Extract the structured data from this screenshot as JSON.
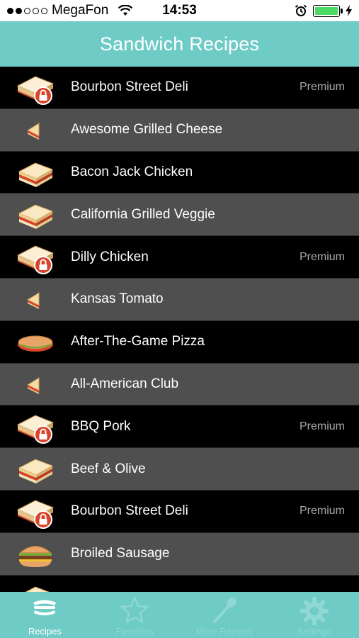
{
  "status_bar": {
    "carrier": "MegaFon",
    "time": "14:53",
    "signal_bars_filled": 2,
    "signal_bars_total": 5,
    "battery_level": 1.0,
    "battery_color": "#4cd964"
  },
  "nav": {
    "title": "Sandwich Recipes",
    "color": "#6ecbc5"
  },
  "recipes": [
    {
      "name": "Bourbon Street Deli",
      "badge": "Premium",
      "icon": "sandwich-locked-icon"
    },
    {
      "name": "Awesome Grilled Cheese",
      "badge": "",
      "icon": "sandwich-wedge-icon"
    },
    {
      "name": "Bacon Jack Chicken",
      "badge": "",
      "icon": "sandwich-icon"
    },
    {
      "name": "California Grilled Veggie",
      "badge": "",
      "icon": "sandwich-icon"
    },
    {
      "name": "Dilly Chicken",
      "badge": "Premium",
      "icon": "sandwich-locked-icon"
    },
    {
      "name": "Kansas Tomato",
      "badge": "",
      "icon": "sandwich-wedge-icon"
    },
    {
      "name": "After-The-Game Pizza",
      "badge": "",
      "icon": "sub-sandwich-icon"
    },
    {
      "name": "All-American Club",
      "badge": "",
      "icon": "sandwich-wedge-icon"
    },
    {
      "name": "BBQ Pork",
      "badge": "Premium",
      "icon": "sandwich-locked-icon"
    },
    {
      "name": "Beef & Olive",
      "badge": "",
      "icon": "sandwich-icon"
    },
    {
      "name": "Bourbon Street Deli",
      "badge": "Premium",
      "icon": "sandwich-locked-icon"
    },
    {
      "name": "Broiled Sausage",
      "badge": "",
      "icon": "burger-icon"
    },
    {
      "name": "",
      "badge": "",
      "icon": "sandwich-icon"
    }
  ],
  "tabs": [
    {
      "label": "Recipes",
      "icon": "sandwich-stack-icon",
      "active": true
    },
    {
      "label": "Favorites",
      "icon": "star-icon",
      "active": false
    },
    {
      "label": "More Recipes",
      "icon": "spoon-icon",
      "active": false
    },
    {
      "label": "Settings",
      "icon": "gear-icon",
      "active": false
    }
  ]
}
